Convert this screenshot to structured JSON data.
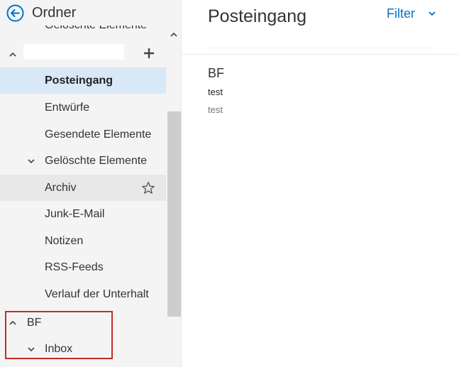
{
  "folder_pane": {
    "title": "Ordner",
    "top_cut_label": "Gelöschte Elemente",
    "account_name": "",
    "folders": [
      {
        "label": "Posteingang",
        "selected": true
      },
      {
        "label": "Entwürfe"
      },
      {
        "label": "Gesendete Elemente"
      },
      {
        "label": "Gelöschte Elemente",
        "expandable": true
      },
      {
        "label": "Archiv",
        "hover": true,
        "favorite_icon": "star-outline-icon"
      },
      {
        "label": "Junk-E-Mail"
      },
      {
        "label": "Notizen"
      },
      {
        "label": "RSS-Feeds"
      },
      {
        "label": "Verlauf der Unterhalt"
      }
    ],
    "bf_group": {
      "label": "BF",
      "children": [
        {
          "label": "Inbox"
        }
      ]
    }
  },
  "message_pane": {
    "title": "Posteingang",
    "filter_label": "Filter",
    "messages": [
      {
        "sender": "BF",
        "subject": "test",
        "preview": "test"
      }
    ]
  },
  "colors": {
    "accent": "#0072c6",
    "selected_bg": "#d9e8f7",
    "highlight_border": "#c42b2b",
    "pane_bg": "#f4f4f4"
  }
}
